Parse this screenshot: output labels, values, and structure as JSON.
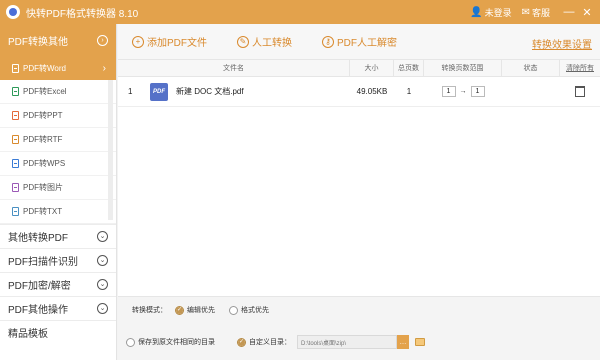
{
  "app": {
    "title": "快转PDF格式转换器 8.10",
    "user_label": "未登录",
    "mail_label": "客服"
  },
  "sidebar": {
    "header": "PDF转换其他",
    "items": [
      {
        "label": "PDF转Word",
        "active": true
      },
      {
        "label": "PDF转Excel"
      },
      {
        "label": "PDF转PPT"
      },
      {
        "label": "PDF转RTF"
      },
      {
        "label": "PDF转WPS"
      },
      {
        "label": "PDF转图片"
      },
      {
        "label": "PDF转TXT"
      }
    ],
    "categories": [
      {
        "label": "其他转换PDF"
      },
      {
        "label": "PDF扫描件识别"
      },
      {
        "label": "PDF加密/解密"
      },
      {
        "label": "PDF其他操作"
      },
      {
        "label": "精品模板"
      }
    ]
  },
  "toolbar": {
    "add_pdf": "添加PDF文件",
    "manual_convert": "人工转换",
    "manual_decrypt": "PDF人工解密",
    "effect_settings": "转换效果设置"
  },
  "table": {
    "headers": [
      "文件名",
      "大小",
      "总页数",
      "转换页数范围",
      "状态",
      "清除所有"
    ],
    "rows": [
      {
        "index": "1",
        "filename": "新建 DOC 文档.pdf",
        "size": "49.05KB",
        "pages": "1",
        "range_from": "1",
        "range_to": "1",
        "status": ""
      }
    ],
    "pdf_icon_text": "PDF"
  },
  "bottom": {
    "mode_label": "转换模式：",
    "mode_options": [
      "编辑优先",
      "格式优先"
    ],
    "same_dir_label": "保存到原文件相同的目录",
    "custom_dir_label": "自定义目录：",
    "custom_dir_value": "D:\\tools\\桌面\\zip\\"
  }
}
